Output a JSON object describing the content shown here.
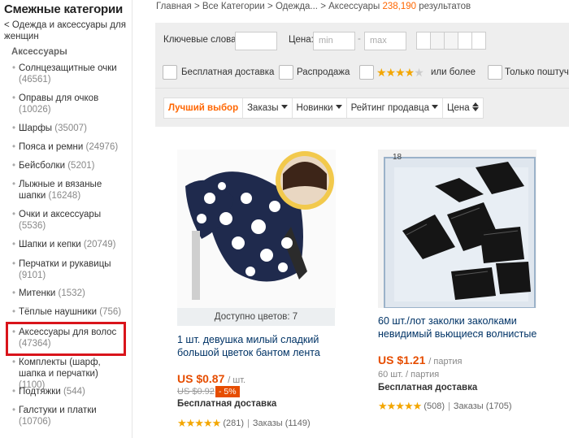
{
  "sidebar": {
    "title": "Смежные категории",
    "back_link": "< Одежда и аксессуары для женщин",
    "subheading": "Аксессуары",
    "items": [
      {
        "label": "Солнцезащитные очки",
        "count": "(46561)"
      },
      {
        "label": "Оправы для очков",
        "count": "(10026)"
      },
      {
        "label": "Шарфы",
        "count": "(35007)"
      },
      {
        "label": "Пояса и ремни",
        "count": "(24976)"
      },
      {
        "label": "Бейсболки",
        "count": "(5201)"
      },
      {
        "label": "Лыжные и вязаные шапки",
        "count": "(16248)"
      },
      {
        "label": "Очки и аксессуары",
        "count": "(5536)"
      },
      {
        "label": "Шапки и кепки",
        "count": "(20749)"
      },
      {
        "label": "Перчатки и рукавицы",
        "count": "(9101)"
      },
      {
        "label": "Митенки",
        "count": "(1532)"
      },
      {
        "label": "Тёплые наушники",
        "count": "(756)"
      },
      {
        "label": "Аксессуары для волос",
        "count": "(47364)"
      },
      {
        "label": "Комплекты (шарф, шапка и перчатки)",
        "count": "(1100)"
      },
      {
        "label": "Подтяжки",
        "count": "(544)"
      },
      {
        "label": "Галстуки и платки",
        "count": "(10706)"
      }
    ]
  },
  "breadcrumb": {
    "path": "Главная > Все Категории > Одежда... > Аксессуары",
    "count": "238,190",
    "suffix": "результатов"
  },
  "filters": {
    "keywords_label": "Ключевые слова:",
    "keywords_value": "",
    "price_label": "Цена:",
    "price_min_placeholder": "min",
    "price_max_placeholder": "max",
    "price_dash": "-",
    "free_shipping_label": "Бесплатная доставка",
    "sale_label": "Распродажа",
    "rating_suffix": "или более",
    "only_wholesale_label": "Только поштучно",
    "star_icon": "star-icon",
    "accent_color": "#f60"
  },
  "sort": {
    "best_match": "Лучший выбор",
    "orders": "Заказы",
    "newest": "Новинки",
    "seller_rating": "Рейтинг продавца",
    "price": "Цена"
  },
  "products": [
    {
      "availability": "Доступно цветов: 7",
      "title": "1 шт. девушка милый сладкий большой цветок бантом лента",
      "price": "US $0.87",
      "unit": "/ шт.",
      "old_price": "US $0.92",
      "discount": "- 5%",
      "shipping": "Бесплатная доставка",
      "reviews": "(281)",
      "orders": "Заказы (1149)",
      "rating": 5
    },
    {
      "title": "60 шт./лот заколки заколками невидимый вьющиеся волнистые",
      "price": "US $1.21",
      "unit": "/ партия",
      "sub_unit": "60 шт. / партия",
      "shipping": "Бесплатная доставка",
      "reviews": "(508)",
      "orders": "Заказы (1705)",
      "rating": 5
    }
  ]
}
